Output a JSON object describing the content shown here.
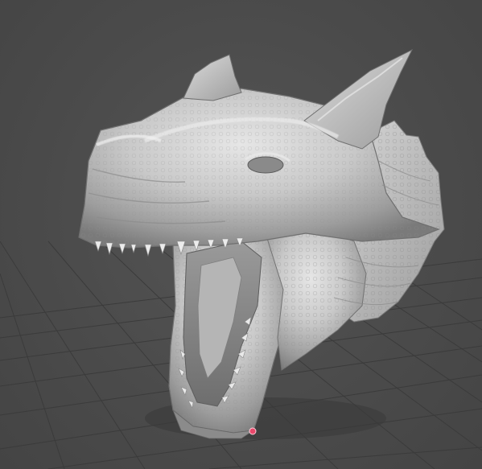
{
  "viewport": {
    "background_color": "#4a4a4a",
    "grid_color": "#3a3a3a",
    "mesh_color": "#d2d2d2",
    "mesh_shadow_color": "#7d7d7d",
    "origin_marker_color": "#e8486a",
    "object": "3d-sculpt-dinosaur-head",
    "marker_icon": "origin-pivot-icon"
  }
}
